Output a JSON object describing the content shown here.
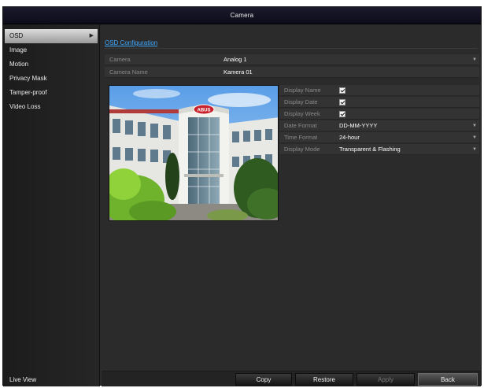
{
  "window": {
    "title": "Camera"
  },
  "sidebar": {
    "items": [
      {
        "label": "OSD",
        "active": true
      },
      {
        "label": "Image"
      },
      {
        "label": "Motion"
      },
      {
        "label": "Privacy Mask"
      },
      {
        "label": "Tamper-proof"
      },
      {
        "label": "Video Loss"
      }
    ],
    "live_view": "Live View"
  },
  "main": {
    "tab": "OSD Configuration",
    "camera": {
      "label": "Camera",
      "value": "Analog 1"
    },
    "camera_name": {
      "label": "Camera Name",
      "value": "Kamera 01"
    },
    "display_name": {
      "label": "Display Name",
      "checked": true
    },
    "display_date": {
      "label": "Display Date",
      "checked": true
    },
    "display_week": {
      "label": "Display Week",
      "checked": true
    },
    "date_format": {
      "label": "Date Format",
      "value": "DD-MM-YYYY"
    },
    "time_format": {
      "label": "Time Format",
      "value": "24-hour"
    },
    "display_mode": {
      "label": "Display Mode",
      "value": "Transparent & Flashing"
    },
    "preview": {
      "sign_text": "ABUS"
    }
  },
  "footer": {
    "copy": "Copy",
    "restore": "Restore",
    "apply": "Apply",
    "back": "Back"
  },
  "colors": {
    "accent": "#3fa9ff",
    "title_bg": "#14142a",
    "panel_bg": "#2b2b2b"
  }
}
